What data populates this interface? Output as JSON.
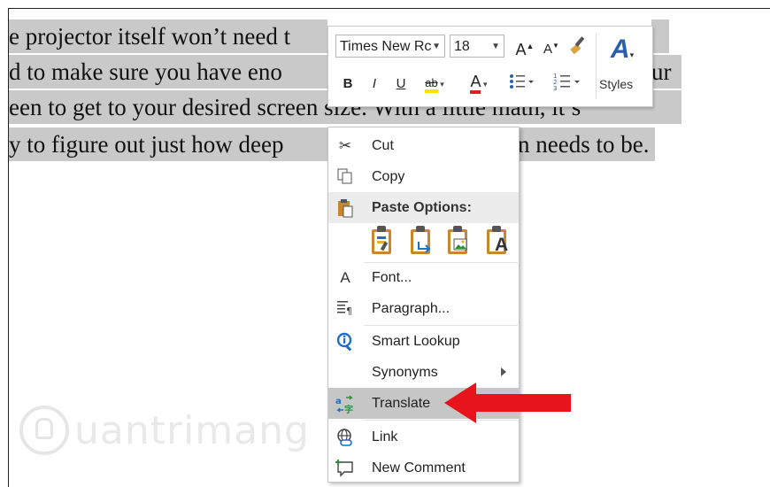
{
  "document": {
    "lines": [
      "e projector itself won’t need t",
      "d to make sure you have eno",
      "een to get to your desired screen size. With a little math, it’s",
      "y to figure out just how deep"
    ],
    "line_right_fragments": [
      "ur",
      "",
      "",
      "n needs to be."
    ]
  },
  "mini_toolbar": {
    "font_name": "Times New Rc",
    "font_size": "18",
    "grow_label": "A",
    "shrink_label": "A",
    "bold_label": "B",
    "italic_label": "I",
    "underline_label": "U",
    "highlight_label": "ab",
    "font_color_label": "A",
    "styles_label": "Styles",
    "styles_icon_label": "A",
    "highlight_color": "#f2e600",
    "font_color": "#e02020",
    "accent": "#2a5fb0"
  },
  "context_menu": {
    "items": [
      {
        "label": "Cut",
        "icon": "scissors-icon"
      },
      {
        "label": "Copy",
        "icon": "copy-icon"
      },
      {
        "label": "Paste Options:",
        "icon": "paste-icon"
      },
      {
        "label": "Font...",
        "icon": "font-icon",
        "glyph": "A"
      },
      {
        "label": "Paragraph...",
        "icon": "paragraph-icon"
      },
      {
        "label": "Smart Lookup",
        "icon": "smart-lookup-icon"
      },
      {
        "label": "Synonyms",
        "icon": ""
      },
      {
        "label": "Translate",
        "icon": "translate-icon"
      },
      {
        "label": "Link",
        "icon": "link-icon"
      },
      {
        "label": "New Comment",
        "icon": "new-comment-icon"
      }
    ],
    "highlighted": "Translate",
    "paste_option_glyph": "A"
  },
  "annotation": {
    "arrow_color": "#e8141b"
  },
  "watermark": {
    "text": "uantrimang"
  }
}
